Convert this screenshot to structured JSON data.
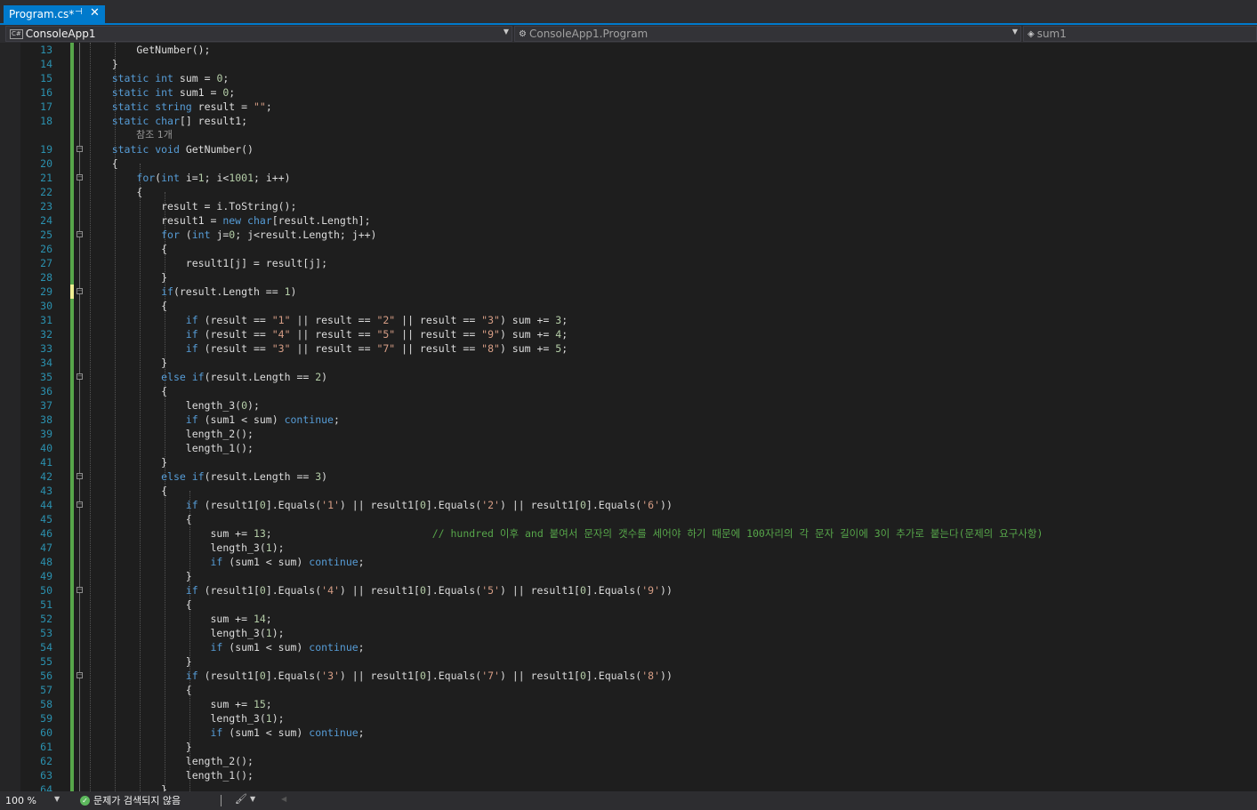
{
  "tab": {
    "title": "Program.cs*",
    "pin_icon": "pin-icon",
    "close_icon": "close-icon"
  },
  "nav": {
    "project": "ConsoleApp1",
    "class_path": "ConsoleApp1.Program",
    "member": "sum1"
  },
  "editor": {
    "codelens": "참조 1개",
    "line_numbers": [
      "13",
      "14",
      "15",
      "16",
      "17",
      "18",
      "19",
      "20",
      "21",
      "22",
      "23",
      "24",
      "25",
      "26",
      "27",
      "28",
      "29",
      "30",
      "31",
      "32",
      "33",
      "34",
      "35",
      "36",
      "37",
      "38",
      "39",
      "40",
      "41",
      "42",
      "43",
      "44",
      "45",
      "46",
      "47",
      "48",
      "49",
      "50",
      "51",
      "52",
      "53",
      "54",
      "55",
      "56",
      "57",
      "58",
      "59",
      "60",
      "61",
      "62",
      "63",
      "64"
    ],
    "lines": [
      "            GetNumber();",
      "        }",
      "        static int sum = 0;",
      "        static int sum1 = 0;",
      "        static string result = \"\";",
      "        static char[] result1;",
      "        static void GetNumber()",
      "        {",
      "            for(int i=1; i<1001; i++)",
      "            {",
      "                result = i.ToString();",
      "                result1 = new char[result.Length];",
      "                for (int j=0; j<result.Length; j++)",
      "                {",
      "                    result1[j] = result[j];",
      "                }",
      "                if(result.Length == 1)",
      "                {",
      "                    if (result == \"1\" || result == \"2\" || result == \"3\") sum += 3;",
      "                    if (result == \"4\" || result == \"5\" || result == \"9\") sum += 4;",
      "                    if (result == \"3\" || result == \"7\" || result == \"8\") sum += 5;",
      "                }",
      "                else if(result.Length == 2)",
      "                {",
      "                    length_3(0);",
      "                    if (sum1 < sum) continue;",
      "                    length_2();",
      "                    length_1();",
      "                }",
      "                else if(result.Length == 3)",
      "                {",
      "                    if (result1[0].Equals('1') || result1[0].Equals('2') || result1[0].Equals('6'))",
      "                    {",
      "                        sum += 13;                          // hundred 이후 and 붙여서 문자의 갯수를 세어야 하기 때문에 100자리의 각 문자 길이에 3이 추가로 붙는다(문제의 요구사항)",
      "                        length_3(1);",
      "                        if (sum1 < sum) continue;",
      "                    }",
      "                    if (result1[0].Equals('4') || result1[0].Equals('5') || result1[0].Equals('9'))",
      "                    {",
      "                        sum += 14;",
      "                        length_3(1);",
      "                        if (sum1 < sum) continue;",
      "                    }",
      "                    if (result1[0].Equals('3') || result1[0].Equals('7') || result1[0].Equals('8'))",
      "                    {",
      "                        sum += 15;",
      "                        length_3(1);",
      "                        if (sum1 < sum) continue;",
      "                    }",
      "                    length_2();",
      "                    length_1();",
      "                }"
    ]
  },
  "status": {
    "zoom": "100 %",
    "issues": "문제가 검색되지 않음"
  },
  "colors": {
    "tab_active": "#007acc",
    "keyword": "#569cd6",
    "string": "#d69d85",
    "comment": "#57a64a",
    "line_number": "#2b91af",
    "change_bar": "#57a64a"
  }
}
